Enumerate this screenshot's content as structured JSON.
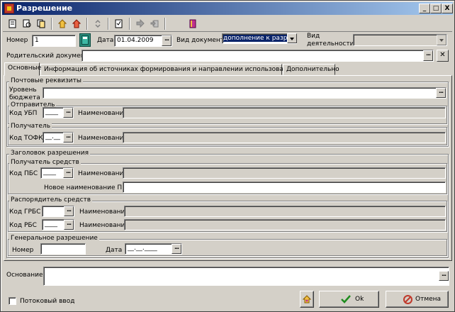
{
  "window": {
    "title": "Разрешение",
    "minimize": "_",
    "maximize": "□",
    "close": "X"
  },
  "header": {
    "number_label": "Номер",
    "number_value": "1",
    "date_label": "Дата",
    "date_value": "01.04.2009",
    "doc_type_label": "Вид документа",
    "doc_type_value": "дополнение к разреш",
    "activity_label_1": "Вид",
    "activity_label_2": "деятельности",
    "activity_value": "",
    "parent_doc_label": "Родительский документ",
    "parent_doc_value": ""
  },
  "tabs": [
    {
      "label": "Основные"
    },
    {
      "label": "Информация об источниках формирования и направлении использования средств"
    },
    {
      "label": "Дополнительно"
    }
  ],
  "postal": {
    "title": "Почтовые реквизиты",
    "budget_level_label_1": "Уровень",
    "budget_level_label_2": "бюджета",
    "budget_level_value": ""
  },
  "sender": {
    "title": "Отправитель",
    "code_label": "Код УБП",
    "code_value": "____",
    "name_label": "Наименование",
    "name_value": ""
  },
  "receiver": {
    "title": "Получатель",
    "code_label": "Код ТОФК",
    "code_value": "__.__",
    "name_label": "Наименование",
    "name_value": ""
  },
  "permission_header": {
    "title": "Заголовок разрешения",
    "recipient_title": "Получатель средств",
    "pbs_code_label": "Код ПБС",
    "pbs_code_value": "____",
    "pbs_name_label": "Наименование",
    "pbs_name_value": "",
    "new_pbs_name_label": "Новое наименование ПБС",
    "new_pbs_name_value": ""
  },
  "disposer": {
    "title": "Распорядитель средств",
    "grbs_label": "Код ГРБС",
    "grbs_value": "",
    "grbs_name_label": "Наименование",
    "grbs_name_value": "",
    "rbs_label": "Код РБС",
    "rbs_value": "____",
    "rbs_name_label": "Наименование",
    "rbs_name_value": ""
  },
  "general_permission": {
    "title": "Генеральное разрешение",
    "number_label": "Номер",
    "number_value": "",
    "date_label": "Дата",
    "date_value": "__.__.____"
  },
  "basis": {
    "label": "Основание",
    "value": ""
  },
  "footer": {
    "stream_input_label": "Потоковый ввод",
    "ok_label": "Ok",
    "cancel_label": "Отмена"
  },
  "colors": {
    "title_start": "#0a246a",
    "title_end": "#a6caf0",
    "face": "#d4d0c8",
    "ok_check": "#1e8c1e",
    "cancel_icon": "#c0392b"
  }
}
